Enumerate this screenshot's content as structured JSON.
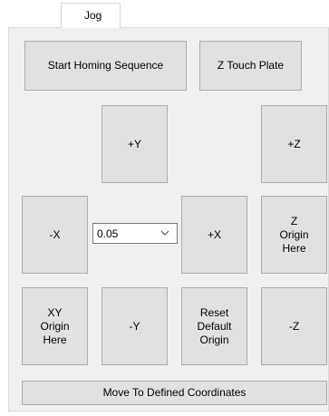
{
  "tabs": [
    {
      "label": "Jog",
      "active": true
    }
  ],
  "buttons": {
    "start_homing": "Start Homing Sequence",
    "z_touch_plate": "Z Touch Plate",
    "plus_y": "+Y",
    "plus_z": "+Z",
    "minus_x": "-X",
    "plus_x": "+X",
    "z_origin_here": "Z\nOrigin\nHere",
    "xy_origin_here": "XY\nOrigin\nHere",
    "minus_y": "-Y",
    "reset_default_origin": "Reset\nDefault\nOrigin",
    "minus_z": "-Z",
    "move_to_coordinates": "Move To Defined Coordinates"
  },
  "step_select": {
    "value": "0.05",
    "icon": "chevron-down-icon"
  }
}
